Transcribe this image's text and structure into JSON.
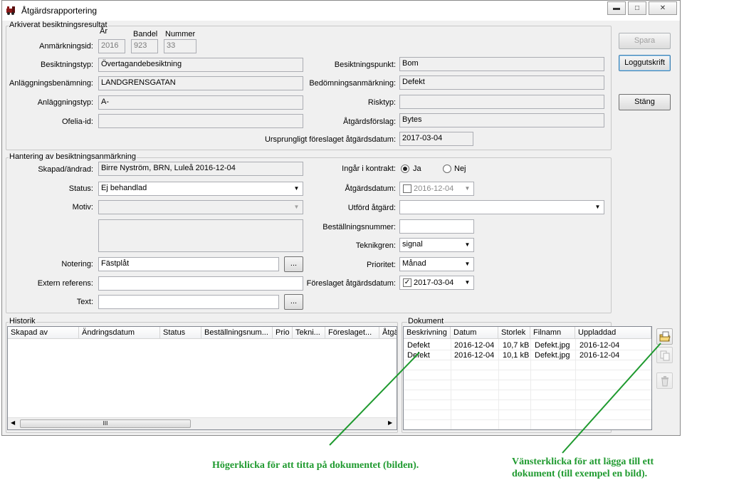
{
  "window": {
    "title": "Åtgärdsrapportering",
    "controls": [
      "minimize-icon",
      "maximize-icon",
      "close-icon"
    ]
  },
  "archived": {
    "legend": "Arkiverat besiktningsresultat",
    "anm_label": "Anmärkningsid:",
    "year_header": "År",
    "bandel_header": "Bandel",
    "nummer_header": "Nummer",
    "year": "2016",
    "bandel": "923",
    "nummer": "33",
    "besiktningstyp_label": "Besiktningstyp:",
    "besiktningstyp": "Övertagandebesiktning",
    "anlaggningsbenamning_label": "Anläggningsbenämning:",
    "anlaggningsbenamning": "LANDGRENSGATAN",
    "anlaggningstyp_label": "Anläggningstyp:",
    "anlaggningstyp": "A-",
    "ofelia_label": "Ofelia-id:",
    "ofelia": "",
    "besiktningspunkt_label": "Besiktningspunkt:",
    "besiktningspunkt": "Bom",
    "bedomning_label": "Bedömningsanmärkning:",
    "bedomning": "Defekt",
    "risktyp_label": "Risktyp:",
    "risktyp": "",
    "atgardsforslag_label": "Åtgärdsförslag:",
    "atgardsforslag": "Bytes",
    "ursprungligt_label": "Ursprungligt föreslaget åtgärdsdatum:",
    "ursprungligt": "2017-03-04"
  },
  "buttons": {
    "spara": "Spara",
    "loggutskrift": "Loggutskrift",
    "stang": "Stäng",
    "dots": "..."
  },
  "handling": {
    "legend": "Hantering av besiktningsanmärkning",
    "skapad_label": "Skapad/ändrad:",
    "skapad": "Birre Nyström, BRN, Luleå  2016-12-04",
    "status_label": "Status:",
    "status": "Ej behandlad",
    "motiv_label": "Motiv:",
    "motiv": "",
    "notering_label": "Notering:",
    "notering": "Fästplåt",
    "extern_label": "Extern referens:",
    "extern": "",
    "text_label": "Text:",
    "text": "",
    "ingar_label": "Ingår i kontrakt:",
    "ja": "Ja",
    "nej": "Nej",
    "ingar_selected": "Ja",
    "atgardsdatum_label": "Åtgärdsdatum:",
    "atgardsdatum": "2016-12-04",
    "utford_label": "Utförd åtgärd:",
    "utford": "",
    "bestallning_label": "Beställningsnummer:",
    "bestallning": "",
    "teknikgren_label": "Teknikgren:",
    "teknikgren": "signal",
    "prioritet_label": "Prioritet:",
    "prioritet": "Månad",
    "foreslaget_label": "Föreslaget åtgärdsdatum:",
    "foreslaget": "2017-03-04"
  },
  "historik": {
    "legend": "Historik",
    "columns": [
      "Skapad av",
      "Ändringsdatum",
      "Status",
      "Beställningsnum...",
      "Prio",
      "Tekni...",
      "Föreslaget...",
      "Åtgä"
    ],
    "scroll_thumb": "III"
  },
  "dokument": {
    "legend": "Dokument",
    "columns": [
      "Beskrivning",
      "Datum",
      "Storlek",
      "Filnamn",
      "Uppladdad"
    ],
    "rows": [
      [
        "Defekt",
        "2016-12-04",
        "10,7 kB",
        "Defekt.jpg",
        "2016-12-04"
      ],
      [
        "Defekt",
        "2016-12-04",
        "10,1 kB",
        "Defekt.jpg",
        "2016-12-04"
      ]
    ],
    "icons": [
      "open-document-icon",
      "copy-document-icon",
      "trash-icon"
    ]
  },
  "annotations": {
    "left": "Högerklicka för att titta på dokumentet (bilden).",
    "right_line1": "Vänsterklicka för att lägga till ett",
    "right_line2": "dokument (till exempel en bild)."
  },
  "colors": {
    "annotation": "#1f9a2f",
    "window_bg": "#f0f0f0"
  }
}
